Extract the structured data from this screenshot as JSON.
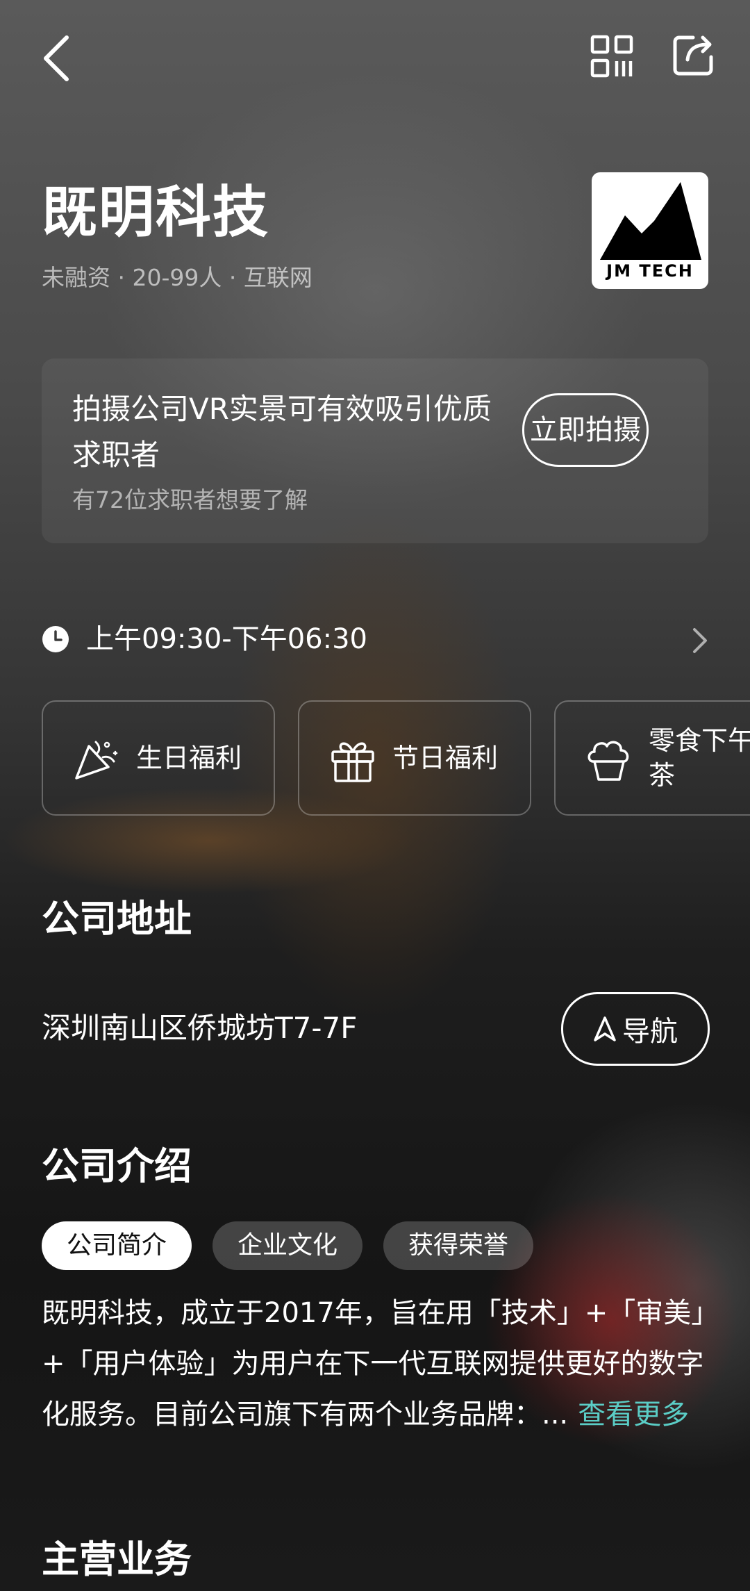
{
  "company": {
    "name": "既明科技",
    "meta": "未融资 · 20-99人 · 互联网",
    "logo_text": "JM TECH"
  },
  "vr_promo": {
    "title": "拍摄公司VR实景可有效吸引优质求职者",
    "subtitle": "有72位求职者想要了解",
    "button_label": "立即拍摄"
  },
  "work_hours": {
    "text": "上午09:30-下午06:30"
  },
  "benefits": [
    {
      "label": "生日福利",
      "icon": "party-popper-icon"
    },
    {
      "label": "节日福利",
      "icon": "gift-icon"
    },
    {
      "label": "零食下午茶",
      "icon": "cupcake-icon"
    }
  ],
  "address": {
    "section_title": "公司地址",
    "text": "深圳南山区侨城坊T7-7F",
    "nav_label": "导航"
  },
  "intro": {
    "section_title": "公司介绍",
    "tabs": [
      {
        "label": "公司简介",
        "active": true
      },
      {
        "label": "企业文化",
        "active": false
      },
      {
        "label": "获得荣誉",
        "active": false
      }
    ],
    "text": "既明科技，成立于2017年，旨在用「技术」+「审美」+「用户体验」为用户在下一代互联网提供更好的数字化服务。目前公司旗下有两个业务品牌：...",
    "more_label": "查看更多"
  },
  "business": {
    "section_title": "主营业务"
  },
  "colors": {
    "accent": "#5bcdc6",
    "text_primary": "#ffffff",
    "chip_active_bg": "#ffffff"
  }
}
